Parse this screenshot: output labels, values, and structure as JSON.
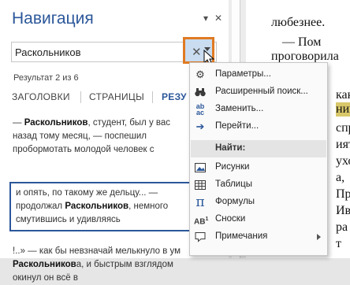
{
  "pane": {
    "title": "Навигация",
    "options_icon": "chevron-down-icon",
    "close_icon": "close-icon"
  },
  "search": {
    "value": "Раскольников",
    "clear_icon": "close-icon",
    "dropdown_icon": "dropdown-arrow-icon"
  },
  "result_count": "Результат 2 из 6",
  "tabs": [
    "ЗАГОЛОВКИ",
    "СТРАНИЦЫ",
    "РЕЗУ"
  ],
  "results": [
    {
      "lines": [
        [
          {
            "t": "— ",
            "b": false
          },
          {
            "t": "Раскольников",
            "b": true
          },
          {
            "t": ", студент, был у вас",
            "b": false
          }
        ],
        [
          {
            "t": "назад тому месяц, — поспешил",
            "b": false
          }
        ],
        [
          {
            "t": "пробормотать молодой человек с",
            "b": false
          }
        ]
      ]
    },
    {
      "lines": [
        [
          {
            "t": "и опять, по такому же дельцу... —",
            "b": false
          }
        ],
        [
          {
            "t": "продолжал ",
            "b": false
          },
          {
            "t": "Раскольников",
            "b": true
          },
          {
            "t": ", немного",
            "b": false
          }
        ],
        [
          {
            "t": "смутившись и удивляясь",
            "b": false
          }
        ]
      ]
    },
    {
      "lines": [
        [
          {
            "t": "!..» — как бы невзначай мелькнуло в ум",
            "b": false
          }
        ],
        [
          {
            "t": "Раскольников",
            "b": true
          },
          {
            "t": "а, и быстрым взглядом",
            "b": false
          }
        ],
        [
          {
            "t": "окинул он всё в",
            "b": false
          }
        ]
      ]
    }
  ],
  "document": {
    "lines": [
      "любезнее.",
      "— Пом",
      "проговорила",
      "как",
      "нико",
      "спр",
      "ият",
      "ухо",
      "а,",
      "Про",
      "Ив",
      "ра",
      "т"
    ]
  },
  "menu": {
    "items": [
      {
        "icon": "options-icon",
        "label": "Параметры..."
      },
      {
        "icon": "binoculars-icon",
        "label": "Расширенный поиск..."
      },
      {
        "icon": "replace-icon",
        "label": "Заменить..."
      },
      {
        "icon": "arrow-right-icon",
        "label": "Перейти..."
      }
    ],
    "find_header": "Найти:",
    "find_items": [
      {
        "icon": "image-icon",
        "label": "Рисунки"
      },
      {
        "icon": "table-icon",
        "label": "Таблицы"
      },
      {
        "icon": "formula-icon",
        "label": "Формулы"
      },
      {
        "icon": "footnote-icon",
        "label": "Сноски"
      },
      {
        "icon": "comment-icon",
        "label": "Примечания"
      }
    ]
  },
  "colors": {
    "accent": "#2b579a",
    "highlight_border": "#e07a22",
    "doc_highlight": "#d9c86a"
  }
}
